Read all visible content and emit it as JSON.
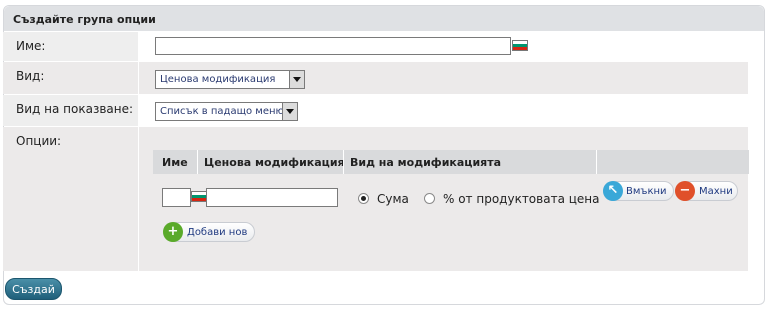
{
  "panel": {
    "title": "Създайте група опции"
  },
  "form": {
    "name_label": "Име:",
    "type_label": "Вид:",
    "type_value": "Ценова модификация",
    "display_label": "Вид на показване:",
    "display_value": "Списък в падащо меню",
    "options_label": "Опции:"
  },
  "options_table": {
    "headers": [
      "Име",
      "Ценова модификация",
      "Вид на модификацията"
    ],
    "radio_sum": "Сума",
    "radio_percent": "% от продуктовата цена",
    "selected": "Сума",
    "insert_button": "Вмъкни",
    "remove_button": "Махни",
    "add_new_button": "Добави нов"
  },
  "submit_button": "Създай",
  "icons": [
    "flag-bg-icon",
    "dropdown-arrow-icon",
    "insert-up-arrow-icon",
    "remove-minus-icon",
    "add-plus-icon"
  ],
  "colors": {
    "header_bg": "#dfe1e4",
    "row_bg": "#eceaea",
    "submit_bg": "#2a6f8c",
    "insert_icon": "#3aa8d8",
    "remove_icon": "#e0502a",
    "add_icon": "#5aaa2a"
  }
}
